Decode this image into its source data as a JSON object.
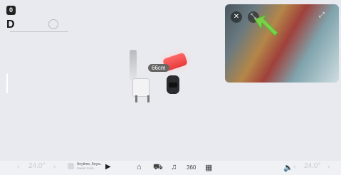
{
  "status": {
    "badge": "0",
    "gear": "D"
  },
  "scene": {
    "distance_label": "66cm"
  },
  "camera": {
    "close_symbol": "✕",
    "shrink_symbol": "⤡",
    "expand_symbol": "⤢"
  },
  "bottom_bar": {
    "left_temp": "24.0°",
    "right_temp": "24.0°",
    "left_arrow": "‹",
    "right_arrow": "›",
    "song_title": "Anytime, Anyw..",
    "song_artist": "Sweet Insid..",
    "play_symbol": "▶",
    "icons": [
      "home-icon",
      "car-icon",
      "music-icon",
      "360-view-icon",
      "apps-icon",
      "volume-icon"
    ],
    "view360_label": "360"
  },
  "colors": {
    "arrow": "#7bd14b",
    "obstacle": "#e83a3a"
  }
}
